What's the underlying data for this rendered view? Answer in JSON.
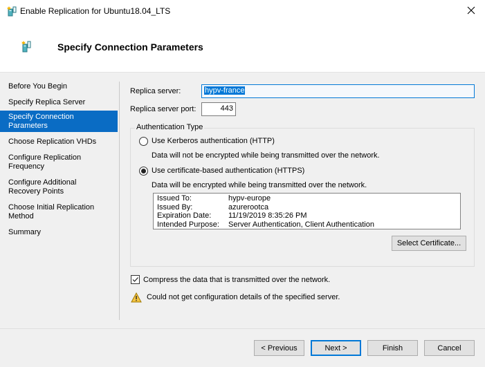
{
  "window": {
    "title": "Enable Replication for Ubuntu18.04_LTS",
    "icon": "replication-server-icon",
    "close_icon": "close-icon"
  },
  "header": {
    "title": "Specify Connection Parameters",
    "icon": "replication-server-icon"
  },
  "nav": {
    "items": [
      {
        "label": "Before You Begin",
        "active": false
      },
      {
        "label": "Specify Replica Server",
        "active": false
      },
      {
        "label": "Specify Connection Parameters",
        "active": true
      },
      {
        "label": "Choose Replication VHDs",
        "active": false
      },
      {
        "label": "Configure Replication Frequency",
        "active": false
      },
      {
        "label": "Configure Additional Recovery Points",
        "active": false
      },
      {
        "label": "Choose Initial Replication Method",
        "active": false
      },
      {
        "label": "Summary",
        "active": false
      }
    ]
  },
  "form": {
    "replica_server_label": "Replica server:",
    "replica_server_value": "hypv-france",
    "replica_port_label": "Replica server port:",
    "replica_port_value": "443",
    "auth_group_label": "Authentication Type",
    "auth_options": [
      {
        "label": "Use Kerberos authentication (HTTP)",
        "selected": false,
        "description": "Data will not be encrypted while being transmitted over the network."
      },
      {
        "label": "Use certificate-based authentication (HTTPS)",
        "selected": true,
        "description": "Data will be encrypted while being transmitted over the network."
      }
    ],
    "certificate": {
      "rows": [
        {
          "key": "Issued To:",
          "value": "hypv-europe"
        },
        {
          "key": "Issued By:",
          "value": "azurerootca"
        },
        {
          "key": "Expiration Date:",
          "value": "11/19/2019 8:35:26 PM"
        },
        {
          "key": "Intended Purpose:",
          "value": "Server Authentication, Client Authentication"
        }
      ],
      "select_button": "Select Certificate..."
    },
    "compress_label": "Compress the data that is transmitted over the network.",
    "compress_checked": true,
    "warning_text": "Could not get configuration details of the specified server."
  },
  "footer": {
    "previous": "< Previous",
    "next": "Next >",
    "finish": "Finish",
    "cancel": "Cancel"
  },
  "colors": {
    "accent": "#0078d7",
    "nav_active_bg": "#0a6cc4",
    "warning": "#f5c542"
  }
}
